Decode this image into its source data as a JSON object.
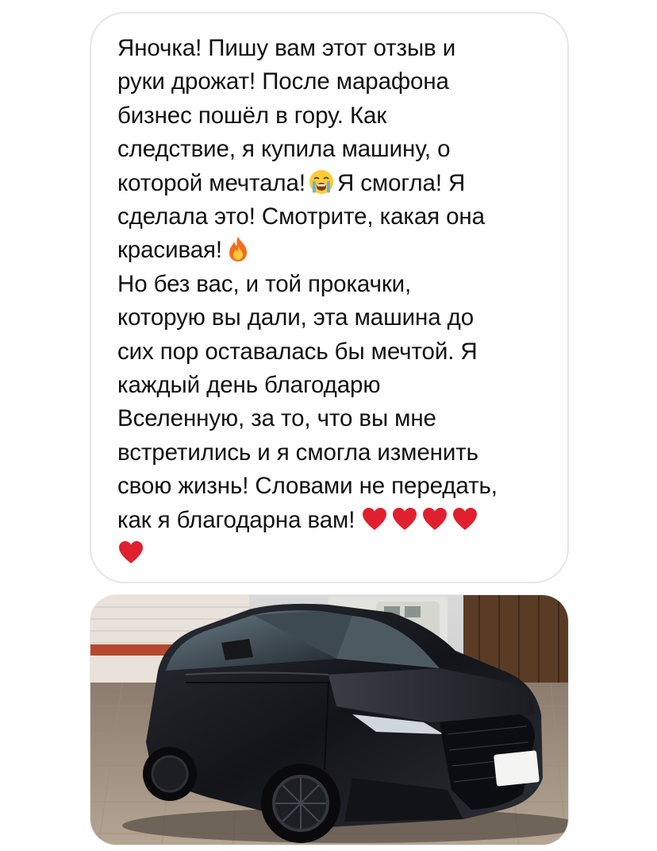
{
  "message": {
    "lines": [
      {
        "text": "Яночка! Пишу вам этот отзыв и"
      },
      {
        "text": "руки дрожат! После марафона"
      },
      {
        "text": "бизнес пошёл в гору. Как"
      },
      {
        "text": "следствие, я купила машину, о"
      },
      {
        "text": "которой мечтала!",
        "emoji": "crying-face-icon",
        "after": "Я смогла! Я"
      },
      {
        "text": "сделала это! Смотрите, какая она"
      },
      {
        "text": "красивая!",
        "emoji": "fire-icon"
      },
      {
        "text": "Но без вас, и той прокачки,"
      },
      {
        "text": "которую вы дали, эта машина до"
      },
      {
        "text": "сих пор оставалась бы мечтой. Я"
      },
      {
        "text": "каждый день благодарю"
      },
      {
        "text": "Вселенную, за то, что вы мне"
      },
      {
        "text": "встретились и я смогла изменить"
      },
      {
        "text": "свою жизнь! Словами не передать,"
      },
      {
        "text": "как я благодарна вам!",
        "hearts": 4
      },
      {
        "text": "",
        "hearts": 1
      }
    ]
  },
  "colors": {
    "text": "#111111",
    "bubble_border": "#e6e6e6",
    "heart": "#e0202f",
    "car_body": "#16181d"
  },
  "photo": {
    "subject": "car-photo"
  }
}
